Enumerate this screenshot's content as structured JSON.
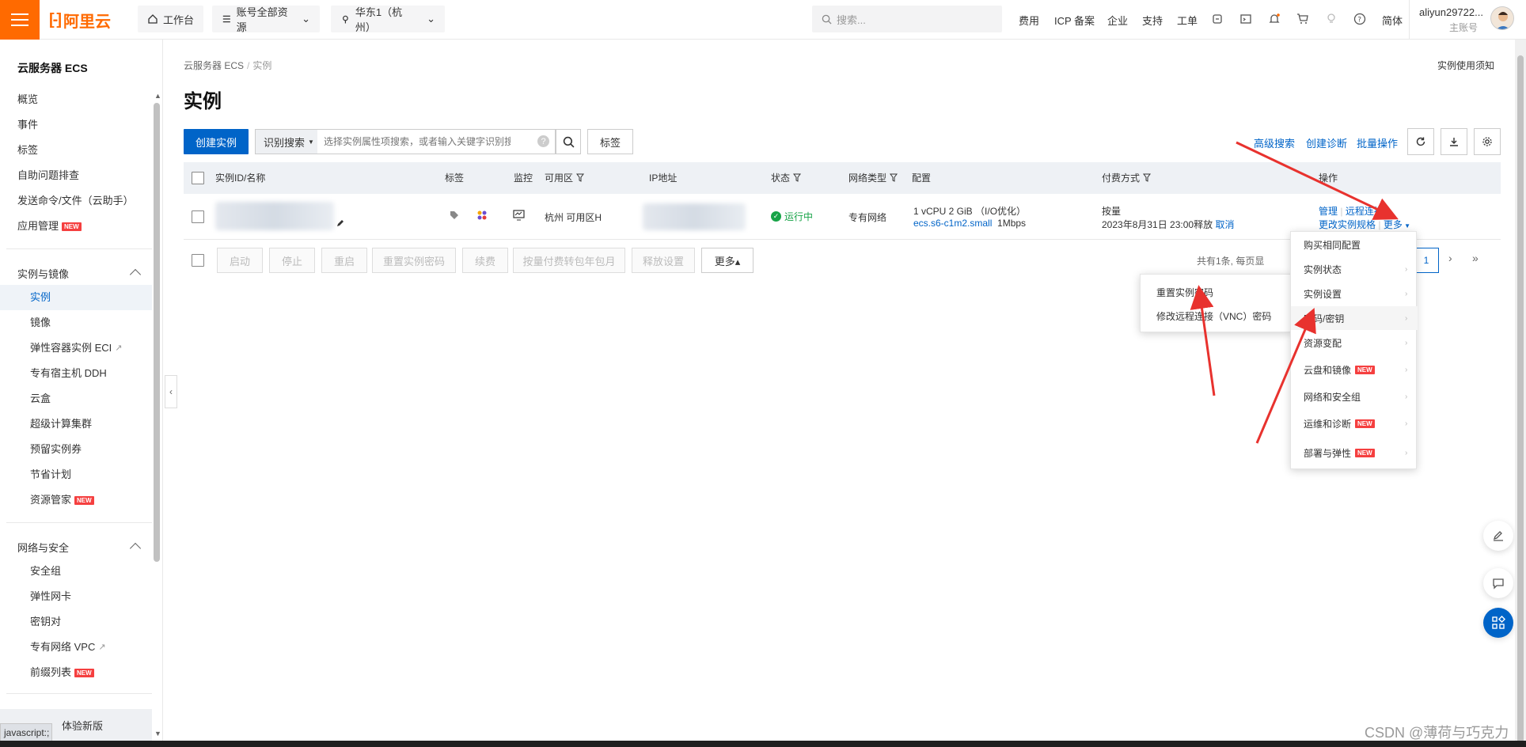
{
  "topbar": {
    "logo_text": "阿里云",
    "workbench": "工作台",
    "resources": "账号全部资源",
    "region": "华东1（杭州）",
    "search_placeholder": "搜索...",
    "links": [
      "费用",
      "ICP 备案",
      "企业",
      "支持",
      "工单"
    ],
    "lang": "简体",
    "username": "aliyun29722...",
    "account_type": "主账号"
  },
  "sidebar": {
    "title": "云服务器 ECS",
    "items": [
      "概览",
      "事件",
      "标签",
      "自助问题排查",
      "发送命令/文件（云助手）",
      "应用管理"
    ],
    "group1": {
      "title": "实例与镜像",
      "items": [
        "实例",
        "镜像",
        "弹性容器实例 ECI",
        "专有宿主机 DDH",
        "云盒",
        "超级计算集群",
        "预留实例券",
        "节省计划",
        "资源管家"
      ]
    },
    "group2": {
      "title": "网络与安全",
      "items": [
        "安全组",
        "弹性网卡",
        "密钥对",
        "专有网络 VPC",
        "前缀列表"
      ]
    },
    "try_new": "体验新版",
    "new_tag": "NEW"
  },
  "statusbar": "javascript:;",
  "main": {
    "breadcrumb_root": "云服务器 ECS",
    "breadcrumb_sep": "/",
    "breadcrumb_current": "实例",
    "title": "实例",
    "notice": "实例使用须知",
    "create_button": "创建实例",
    "search_mode": "识别搜索",
    "search_placeholder": "选择实例属性项搜索，或者输入关键字识别搜索",
    "tag_button": "标签",
    "advanced_search": "高级搜索",
    "create_diagnosis": "创建诊断",
    "batch_ops": "批量操作"
  },
  "table": {
    "headers": [
      "实例ID/名称",
      "标签",
      "监控",
      "可用区",
      "IP地址",
      "状态",
      "网络类型",
      "配置",
      "付费方式",
      "操作"
    ],
    "row": {
      "zone": "杭州 可用区H",
      "status": "运行中",
      "network": "专有网络",
      "config_line1": "1 vCPU 2 GiB （I/O优化）",
      "config_type": "ecs.s6-c1m2.small",
      "bandwidth": "1Mbps",
      "billing": "按量",
      "release_time": "2023年8月31日 23:00释放",
      "cancel": "取消",
      "op_manage": "管理",
      "op_remote": "远程连接",
      "op_change": "更改实例规格",
      "op_more": "更多"
    }
  },
  "footer": {
    "buttons": [
      "启动",
      "停止",
      "重启",
      "重置实例密码",
      "续费",
      "按量付费转包年包月",
      "释放设置"
    ],
    "more": "更多▴",
    "page_info": "共有1条, 每页显",
    "current_page": "1"
  },
  "more_menu": {
    "items": [
      "购买相同配置",
      "实例状态",
      "实例设置",
      "密码/密钥",
      "资源变配",
      "云盘和镜像",
      "网络和安全组",
      "运维和诊断",
      "部署与弹性"
    ]
  },
  "password_menu": {
    "items": [
      "重置实例密码",
      "修改远程连接（VNC）密码"
    ]
  },
  "watermark": "CSDN @薄荷与巧克力",
  "colors": {
    "brand": "#ff6a00",
    "primary": "#0064c8",
    "running": "#17a347",
    "arrow": "#e8322e"
  }
}
